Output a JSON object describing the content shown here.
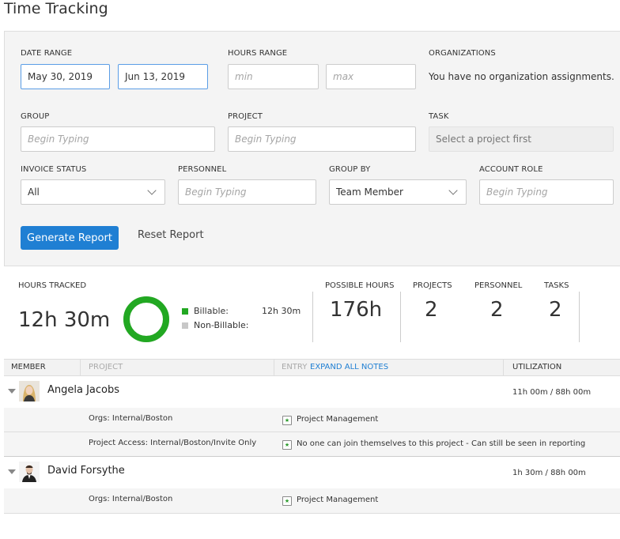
{
  "page": {
    "title": "Time Tracking"
  },
  "filters": {
    "date_range": {
      "label": "DATE RANGE",
      "start": "May 30, 2019",
      "end": "Jun 13, 2019"
    },
    "hours_range": {
      "label": "HOURS RANGE",
      "min_placeholder": "min",
      "max_placeholder": "max"
    },
    "organizations": {
      "label": "ORGANIZATIONS",
      "value": "You have no organization assignments."
    },
    "group": {
      "label": "GROUP",
      "placeholder": "Begin Typing"
    },
    "project": {
      "label": "PROJECT",
      "placeholder": "Begin Typing"
    },
    "task": {
      "label": "TASK",
      "value": "Select a project first"
    },
    "invoice_status": {
      "label": "INVOICE STATUS",
      "value": "All"
    },
    "personnel": {
      "label": "PERSONNEL",
      "placeholder": "Begin Typing"
    },
    "group_by": {
      "label": "GROUP BY",
      "value": "Team Member"
    },
    "account_role": {
      "label": "ACCOUNT ROLE",
      "placeholder": "Begin Typing"
    },
    "generate_label": "Generate Report",
    "reset_label": "Reset Report"
  },
  "summary": {
    "hours_tracked_label": "HOURS TRACKED",
    "hours_tracked": "12h 30m",
    "billable_label": "Billable:",
    "billable_value": "12h 30m",
    "non_billable_label": "Non-Billable:",
    "billable_color": "#22a822",
    "non_billable_color": "#c8c8c8",
    "billable_fraction": 1.0,
    "possible_hours_label": "POSSIBLE HOURS",
    "possible_hours": "176h",
    "projects_label": "PROJECTS",
    "projects": "2",
    "personnel_label": "PERSONNEL",
    "personnel": "2",
    "tasks_label": "TASKS",
    "tasks": "2"
  },
  "table": {
    "headers": {
      "member": "MEMBER",
      "project": "PROJECT",
      "entry": "ENTRY",
      "expand": "EXPAND ALL NOTES",
      "utilization": "UTILIZATION"
    },
    "members": [
      {
        "name": "Angela Jacobs",
        "utilization": "11h 00m / 88h 00m",
        "details": [
          {
            "left": "Orgs: Internal/Boston",
            "text": "Project Management"
          },
          {
            "left": "Project Access: Internal/Boston/Invite Only",
            "text": "No one can join themselves to this project - Can still be seen in reporting"
          }
        ]
      },
      {
        "name": "David Forsythe",
        "utilization": "1h 30m / 88h 00m",
        "details": [
          {
            "left": "Orgs: Internal/Boston",
            "text": "Project Management"
          }
        ]
      }
    ]
  },
  "colors": {
    "accent": "#1f7fd3",
    "focus_border": "#5a9de6"
  }
}
